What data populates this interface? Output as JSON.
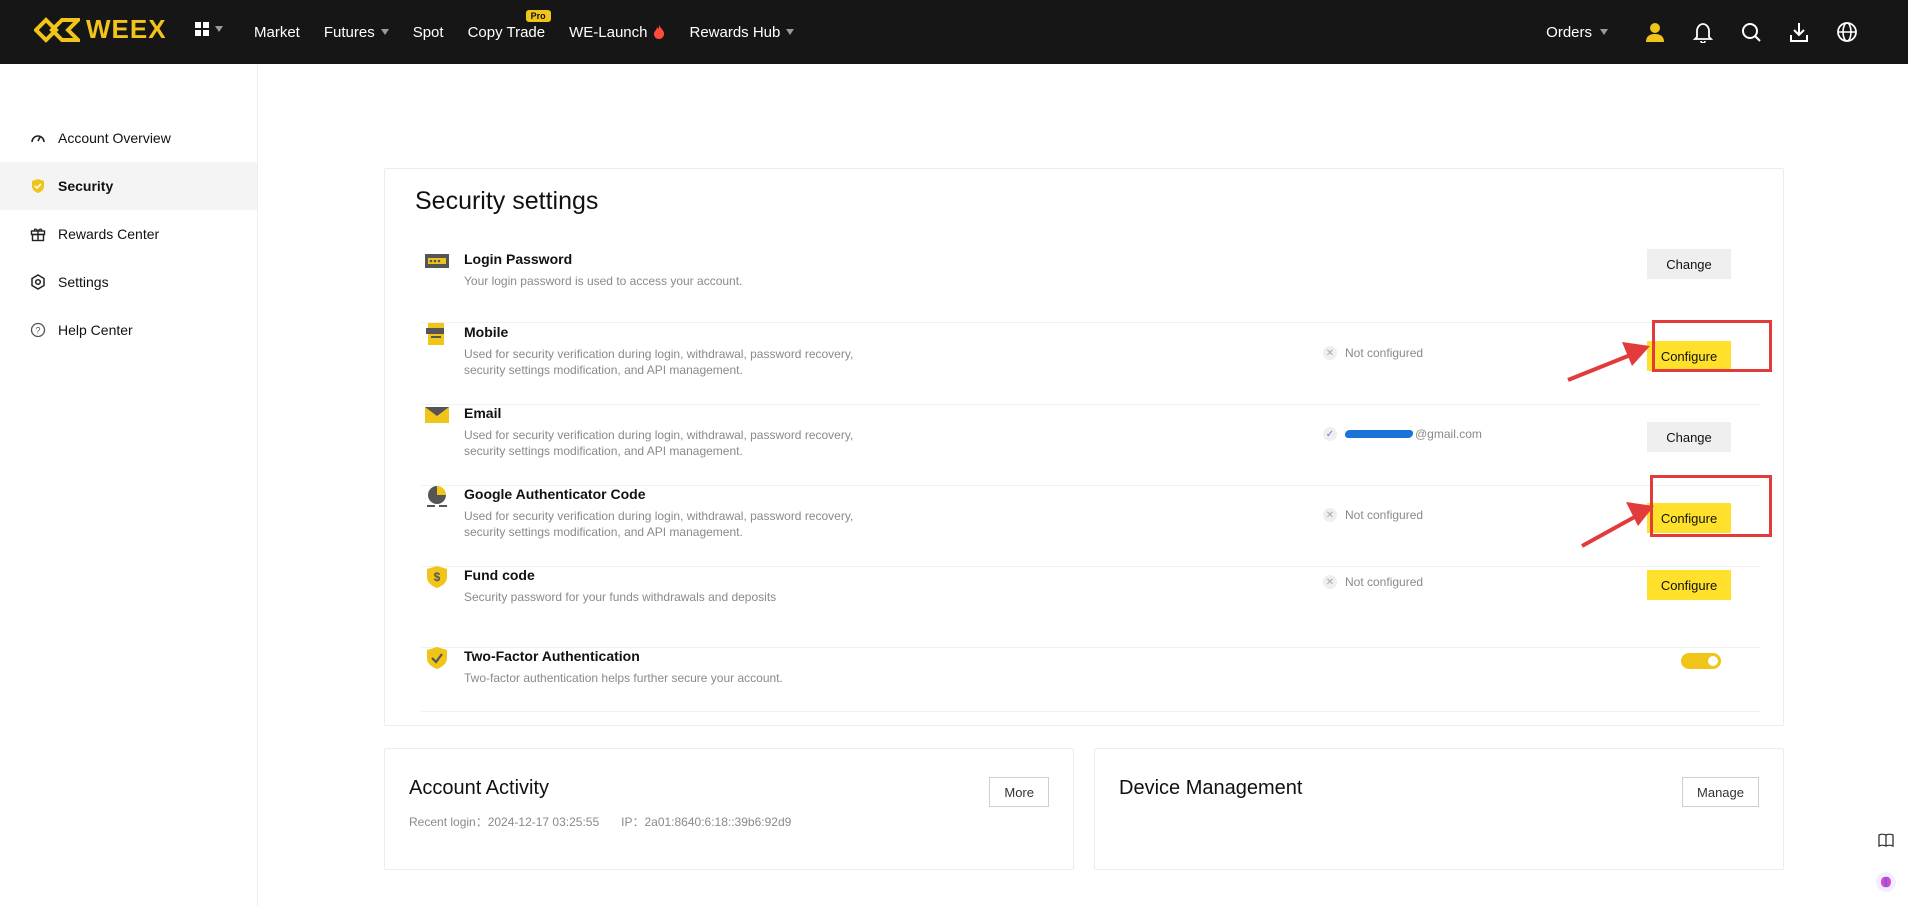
{
  "brand": {
    "name": "WEEX",
    "color": "#f0c419"
  },
  "nav": {
    "items": [
      {
        "label": "Market"
      },
      {
        "label": "Futures"
      },
      {
        "label": "Spot"
      },
      {
        "label": "Copy Trade",
        "badge": "Pro"
      },
      {
        "label": "WE-Launch"
      },
      {
        "label": "Rewards Hub"
      }
    ],
    "orders": "Orders"
  },
  "sidebar": {
    "items": [
      {
        "label": "Account Overview"
      },
      {
        "label": "Security"
      },
      {
        "label": "Rewards Center"
      },
      {
        "label": "Settings"
      },
      {
        "label": "Help Center"
      }
    ]
  },
  "security": {
    "title": "Security settings",
    "rows": [
      {
        "title": "Login Password",
        "desc": "Your login password is used to access your account.",
        "status": "",
        "action": "Change"
      },
      {
        "title": "Mobile",
        "desc": "Used for security verification during login, withdrawal, password recovery, security settings modification, and API management.",
        "status": "Not configured",
        "action": "Configure"
      },
      {
        "title": "Email",
        "desc": "Used for security verification during login, withdrawal, password recovery, security settings modification, and API management.",
        "status": "@gmail.com",
        "action": "Change"
      },
      {
        "title": "Google Authenticator Code",
        "desc": "Used for security verification during login, withdrawal, password recovery, security settings modification, and API management.",
        "status": "Not configured",
        "action": "Configure"
      },
      {
        "title": "Fund code",
        "desc": "Security password for your funds withdrawals and deposits",
        "status": "Not configured",
        "action": "Configure"
      },
      {
        "title": "Two-Factor Authentication",
        "desc": "Two-factor authentication helps further secure your account.",
        "status": "",
        "action": ""
      }
    ]
  },
  "activity": {
    "title": "Account Activity",
    "more": "More",
    "recent_login": "Recent login：2024-12-17 03:25:55",
    "ip": "IP：2a01:8640:6:18::39b6:92d9"
  },
  "devices": {
    "title": "Device Management",
    "manage": "Manage"
  }
}
